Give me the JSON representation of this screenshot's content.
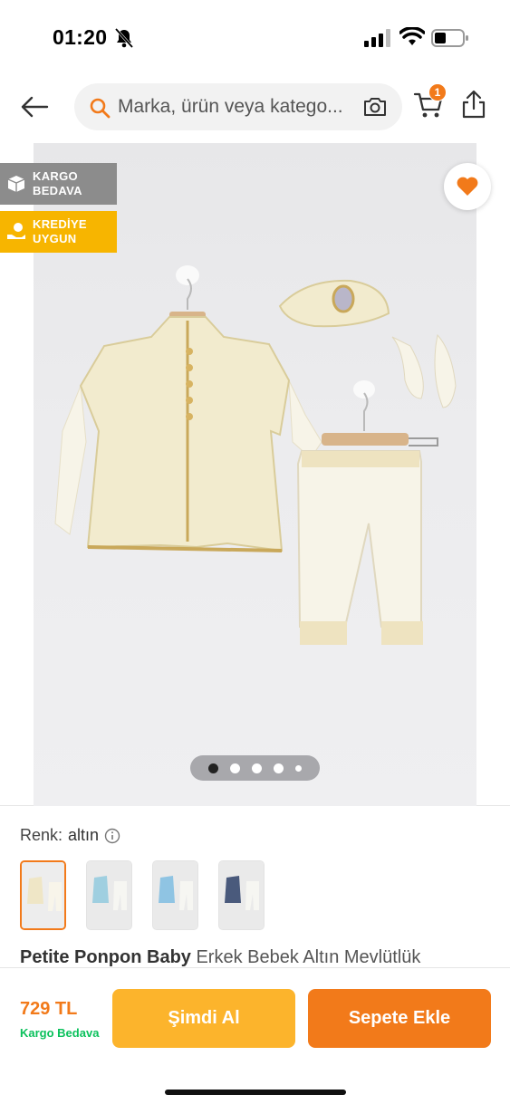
{
  "status_bar": {
    "time": "01:20"
  },
  "header": {
    "search_placeholder": "Marka, ürün veya katego...",
    "cart_count": "1"
  },
  "gallery": {
    "badges": [
      {
        "line1": "KARGO",
        "line2": "BEDAVA"
      },
      {
        "line1": "KREDİYE",
        "line2": "UYGUN"
      }
    ],
    "dots_total": 5,
    "dots_active": 1
  },
  "product": {
    "color_label": "Renk:",
    "color_value": "altın",
    "brand": "Petite Ponpon Baby",
    "name": "Erkek Bebek Altın Mevlütlük"
  },
  "bottom_bar": {
    "price": "729 TL",
    "shipping": "Kargo Bedava",
    "buy_now": "Şimdi Al",
    "add_to_cart": "Sepete Ekle"
  },
  "colors": {
    "accent": "#f27a1a",
    "buy_button": "#fcb42c",
    "badge_gray": "#8c8c8c",
    "badge_yellow": "#f7b500",
    "free_shipping": "#0bc15c"
  }
}
